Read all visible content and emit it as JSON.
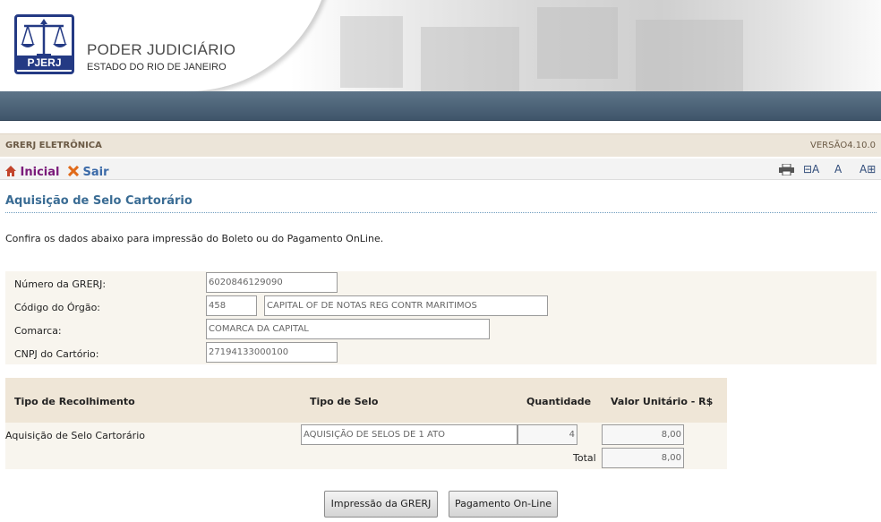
{
  "header": {
    "logo_text": "PJERJ",
    "org_title": "PODER JUDICIÁRIO",
    "org_subtitle": "ESTADO DO RIO DE JANEIRO"
  },
  "system_bar": {
    "name": "GRERJ ELETRÔNICA",
    "version": "VERSÃO4.10.0"
  },
  "toolbar": {
    "home_label": "Inicial",
    "exit_label": "Sair",
    "print_icon": "printer-icon",
    "font_decrease": "⊟A",
    "font_normal": "A",
    "font_increase": "A⊞"
  },
  "page": {
    "title": "Aquisição de Selo Cartorário",
    "intro": "Confira os dados abaixo para impressão do Boleto ou do Pagamento OnLine."
  },
  "form": {
    "grerj_label": "Número da GRERJ:",
    "grerj_value": "6020846129090",
    "orgao_label": "Código do Órgão:",
    "orgao_code": "458",
    "orgao_name": "CAPITAL OF DE NOTAS REG CONTR MARITIMOS",
    "comarca_label": "Comarca:",
    "comarca_value": "COMARCA DA CAPITAL",
    "cnpj_label": "CNPJ do Cartório:",
    "cnpj_value": "27194133000100"
  },
  "table": {
    "headers": [
      "Tipo de Recolhimento",
      "Tipo de Selo",
      "Quantidade",
      "Valor Unitário - R$"
    ],
    "row": {
      "tipo_recolhimento": "Aquisição de Selo Cartorário",
      "tipo_selo": "AQUISIÇÃO DE SELOS DE 1 ATO",
      "quantidade": "4",
      "valor_unitario": "8,00"
    },
    "total_label": "Total",
    "total_value": "8,00"
  },
  "buttons": {
    "print_grerj": "Impressão da GRERJ",
    "pay_online": "Pagamento On-Line"
  },
  "colors": {
    "brand_blue": "#243a84",
    "nav_bar": "#4a6075",
    "title_blue": "#3a6c94",
    "beige": "#efe6d7"
  }
}
